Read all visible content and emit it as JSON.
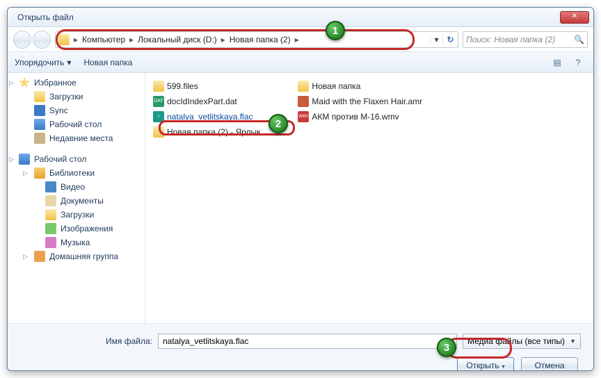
{
  "dialog": {
    "title": "Открыть файл",
    "close": "✕"
  },
  "breadcrumb": {
    "segments": [
      "Компьютер",
      "Локальный диск (D:)",
      "Новая папка (2)"
    ],
    "drop": "▾",
    "refresh": "↻"
  },
  "search": {
    "placeholder": "Поиск: Новая папка (2)",
    "icon": "🔍"
  },
  "toolbar": {
    "organize": "Упорядочить",
    "organize_dd": "▾",
    "newfolder": "Новая папка",
    "view_icon": "▤",
    "help_icon": "?"
  },
  "sidebar": {
    "favorites": {
      "label": "Избранное",
      "expander": "▷"
    },
    "fav_items": [
      {
        "label": "Загрузки",
        "cls": "folder"
      },
      {
        "label": "Sync",
        "cls": "sync"
      },
      {
        "label": "Рабочий стол",
        "cls": "desk"
      },
      {
        "label": "Недавние места",
        "cls": "recent"
      }
    ],
    "desktop": {
      "label": "Рабочий стол",
      "expander": "▷"
    },
    "libraries": {
      "label": "Библиотеки",
      "expander": "▷"
    },
    "lib_items": [
      {
        "label": "Видео",
        "cls": "video"
      },
      {
        "label": "Документы",
        "cls": "doc"
      },
      {
        "label": "Загрузки",
        "cls": "folder"
      },
      {
        "label": "Изображения",
        "cls": "img"
      },
      {
        "label": "Музыка",
        "cls": "music"
      }
    ],
    "homegroup": {
      "label": "Домашняя группа",
      "expander": "▷"
    }
  },
  "files": {
    "col1": [
      {
        "label": "599.files",
        "cls": "folder"
      },
      {
        "label": "docIdIndexPart.dat",
        "cls": "dat",
        "badge": "DAT"
      },
      {
        "label": "natalya_vetlitskaya.flac",
        "cls": "flac",
        "badge": "♪",
        "selected": true
      },
      {
        "label": "Новая папка (2) - Ярлык",
        "cls": "lnk"
      }
    ],
    "col2": [
      {
        "label": "Новая папка",
        "cls": "folder"
      },
      {
        "label": "Maid with the Flaxen Hair.amr",
        "cls": "amr"
      },
      {
        "label": "АКМ против М-16.wmv",
        "cls": "wmv",
        "badge": "WMV"
      }
    ]
  },
  "footer": {
    "filename_label": "Имя файла:",
    "filename_value": "natalya_vetlitskaya.flac",
    "filter_label": "Медиа файлы (все типы)",
    "open_label": "Открыть",
    "open_dd": "▾",
    "cancel_label": "Отмена"
  },
  "annotations": {
    "b1": "1",
    "b2": "2",
    "b3": "3"
  }
}
